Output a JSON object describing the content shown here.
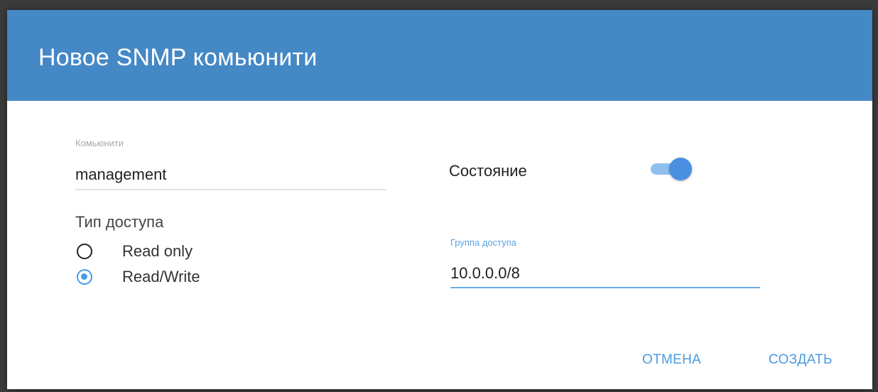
{
  "dialog": {
    "title": "Новое SNMP комьюнити"
  },
  "community": {
    "label": "Комьюнити",
    "value": "management"
  },
  "access_type": {
    "label": "Тип доступа",
    "options": [
      {
        "label": "Read only",
        "selected": false
      },
      {
        "label": "Read/Write",
        "selected": true
      }
    ]
  },
  "state": {
    "label": "Состояние",
    "enabled": true
  },
  "access_group": {
    "label": "Группа доступа",
    "value": "10.0.0.0/8"
  },
  "actions": {
    "cancel_label": "ОТМЕНА",
    "create_label": "СОЗДАТЬ"
  },
  "colors": {
    "header": "#4488c6",
    "accent": "#4a9be0"
  }
}
